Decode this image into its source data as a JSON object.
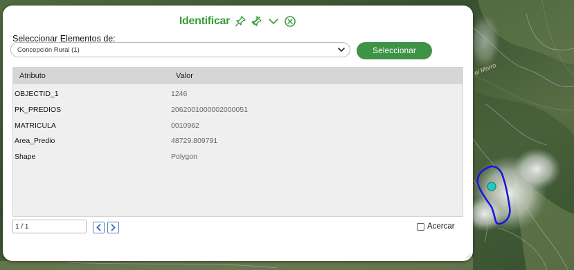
{
  "panel": {
    "title": "Identificar",
    "icons": [
      "pin-icon",
      "unpin-icon",
      "chevron-down-icon",
      "close-circle-icon"
    ]
  },
  "selector": {
    "label": "Seleccionar Elementos de:",
    "selected": "Concepción Rural (1)",
    "button_label": "Seleccionar"
  },
  "table": {
    "headers": [
      "Atributo",
      "Valor"
    ],
    "rows": [
      {
        "attr": "OBJECTID_1",
        "value": "1246"
      },
      {
        "attr": "PK_PREDIOS",
        "value": "2062001000002000051"
      },
      {
        "attr": "MATRICULA",
        "value": "0010962"
      },
      {
        "attr": "Area_Predio",
        "value": "48729.809791"
      },
      {
        "attr": "Shape",
        "value": "Polygon"
      }
    ]
  },
  "pager": {
    "value": "1 / 1"
  },
  "zoom": {
    "label": "Acercar",
    "checked": false
  },
  "map": {
    "label": "el Morro"
  },
  "colors": {
    "accent": "#3e9346",
    "title": "#3a9a3a",
    "polygon": "#1a16e0",
    "marker": "#28c8c0",
    "pager_border": "#4a7fc5"
  }
}
